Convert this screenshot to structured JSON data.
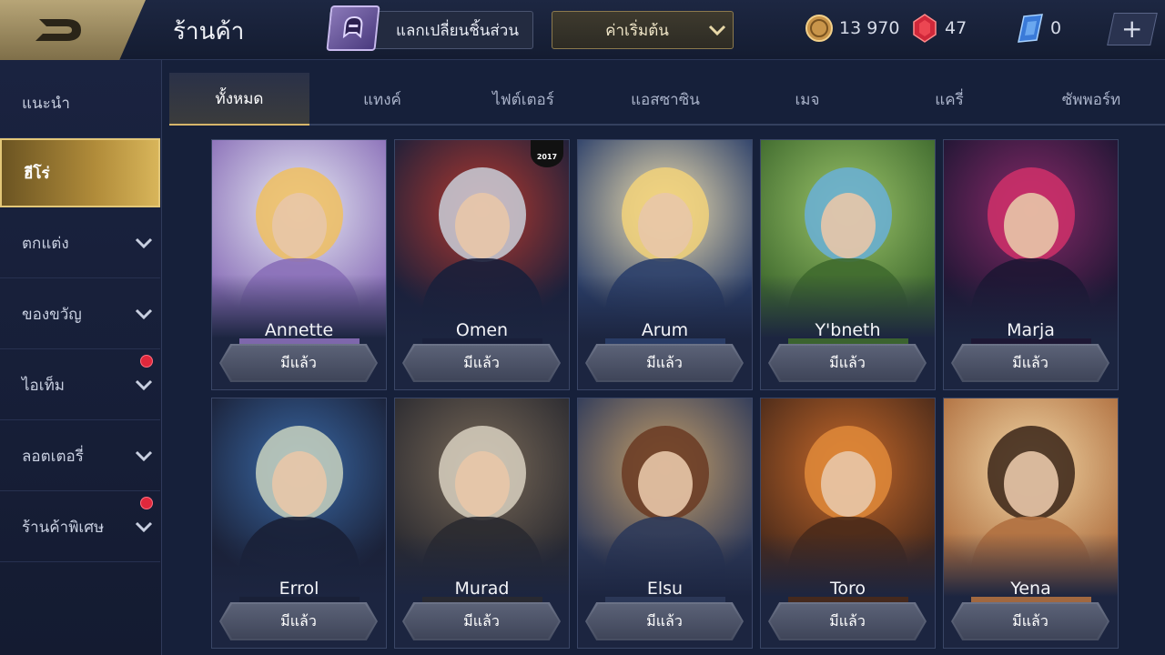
{
  "header": {
    "title": "ร้านค้า",
    "exchange_label": "แลกเปลี่ยนชิ้นส่วน",
    "sort_label": "ค่าเริ่มต้น",
    "currencies": {
      "gold": "13 970",
      "ruby": "47",
      "voucher": "0"
    },
    "plus_label": "+"
  },
  "sidebar": {
    "items": [
      {
        "label": "แนะนำ"
      },
      {
        "label": "ฮีโร่"
      },
      {
        "label": "ตกแต่ง"
      },
      {
        "label": "ของขวัญ"
      },
      {
        "label": "ไอเท็ม"
      },
      {
        "label": "ลอตเตอรี่"
      },
      {
        "label": "ร้านค้าพิเศษ"
      }
    ]
  },
  "tabs": [
    {
      "label": "ทั้งหมด"
    },
    {
      "label": "แทงค์"
    },
    {
      "label": "ไฟต์เตอร์"
    },
    {
      "label": "แอสซาซิน"
    },
    {
      "label": "เมจ"
    },
    {
      "label": "แครี่"
    },
    {
      "label": "ซัพพอร์ท"
    }
  ],
  "owned_label": "มีแล้ว",
  "badge_text": "2017",
  "heroes": [
    {
      "name": "Annette",
      "bg1": "#e9edf5",
      "bg2": "#8a6fb8",
      "hair": "#f0c060"
    },
    {
      "name": "Omen",
      "bg1": "#b5392e",
      "bg2": "#1a1f3a",
      "hair": "#c9ced8"
    },
    {
      "name": "Arum",
      "bg1": "#f3e2b0",
      "bg2": "#2b3f6a",
      "hair": "#f2d27a"
    },
    {
      "name": "Y'bneth",
      "bg1": "#9cc46a",
      "bg2": "#3f6a2e",
      "hair": "#6ab0d8"
    },
    {
      "name": "Marja",
      "bg1": "#8a2a6a",
      "bg2": "#1e1633",
      "hair": "#d0306a"
    },
    {
      "name": "Errol",
      "bg1": "#3a6aa8",
      "bg2": "#1a2036",
      "hair": "#c8d2c0"
    },
    {
      "name": "Murad",
      "bg1": "#7a6a58",
      "bg2": "#2a2a30",
      "hair": "#d8d0c0"
    },
    {
      "name": "Elsu",
      "bg1": "#c8a068",
      "bg2": "#2e3a5a",
      "hair": "#6a3a22"
    },
    {
      "name": "Toro",
      "bg1": "#c86a2a",
      "bg2": "#4a2a1a",
      "hair": "#e08a3a"
    },
    {
      "name": "Yena",
      "bg1": "#f2d8a8",
      "bg2": "#b07040",
      "hair": "#3a2418"
    }
  ]
}
